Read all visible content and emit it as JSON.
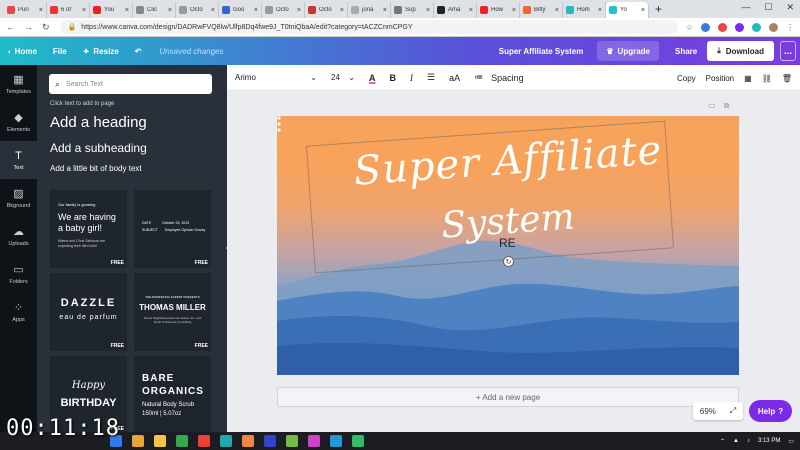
{
  "browser": {
    "tabs": [
      {
        "label": "Pun",
        "color": "#e44"
      },
      {
        "label": "6 of",
        "color": "#e33"
      },
      {
        "label": "You",
        "color": "#e22"
      },
      {
        "label": "Clic",
        "color": "#888"
      },
      {
        "label": "Octo",
        "color": "#999"
      },
      {
        "label": "Goo",
        "color": "#36c"
      },
      {
        "label": "Octo",
        "color": "#999"
      },
      {
        "label": "Octo",
        "color": "#c33"
      },
      {
        "label": "jona",
        "color": "#aaa"
      },
      {
        "label": "Sup",
        "color": "#777"
      },
      {
        "label": "Ama",
        "color": "#222"
      },
      {
        "label": "How",
        "color": "#e22"
      },
      {
        "label": "Bitly",
        "color": "#e63"
      },
      {
        "label": "Hom",
        "color": "#2bb"
      },
      {
        "label": "Yo",
        "color": "#20c4cb",
        "active": true
      }
    ],
    "new_tab": "+",
    "window_controls": [
      "—",
      "☐",
      "✕"
    ],
    "url": "https://www.canva.com/design/DADRwFVQ8lw/Ulfp8Dq4fwe9J_T0tniQbaA/edit?category=tACZCnmCPGY"
  },
  "header": {
    "home": "Home",
    "file": "File",
    "resize": "Resize",
    "unsaved": "Unsaved changes",
    "design_title": "Super Affiliate System",
    "upgrade": "Upgrade",
    "share": "Share",
    "download": "Download",
    "more": "..."
  },
  "rail": {
    "items": [
      {
        "label": "Templates",
        "icon": "▦"
      },
      {
        "label": "Elements",
        "icon": "◆"
      },
      {
        "label": "Text",
        "icon": "T"
      },
      {
        "label": "Bkground",
        "icon": "▨"
      },
      {
        "label": "Uploads",
        "icon": "☁"
      },
      {
        "label": "Folders",
        "icon": "▭"
      },
      {
        "label": "Apps",
        "icon": "⁘"
      }
    ]
  },
  "panel": {
    "search_placeholder": "Search Text",
    "hint": "Click text to add to page",
    "add_heading": "Add a heading",
    "add_subheading": "Add a subheading",
    "add_body": "Add a little bit of body text",
    "free": "FREE",
    "templates": {
      "t1": {
        "small": "Our family is growing",
        "big": "We are having a baby girl!",
        "sub": "Milena and Chris Sebiosta are expecting their third child"
      },
      "t2": {
        "r1a": "DATE",
        "r1b": "October 23, 2019",
        "r2a": "SUBJECT",
        "r2b": "Employee Opinion Survey"
      },
      "t3": {
        "big": "DAZZLE",
        "sub": "eau de parfum"
      },
      "t4": {
        "small": "THE MARKETING EXPERT PRESENTS",
        "big": "THOMAS MILLER",
        "sub": "Senior Digital Executive at Larana, Inc. and Smith & Partners Consulting"
      },
      "t5": {
        "line1": "Happy",
        "line2": "BIRTHDAY"
      },
      "t6": {
        "line1": "BARE",
        "line2": "ORGANICS",
        "line3": "Natural Body Scrub",
        "line4": "150ml | 5.07oz"
      }
    }
  },
  "toolbar": {
    "font": "Arimo",
    "size": "24",
    "color_icon": "A",
    "bold": "B",
    "italic": "I",
    "case": "aA",
    "spacing": "Spacing",
    "copy": "Copy",
    "position": "Position"
  },
  "canvas": {
    "title_line1": "Super Affiliate",
    "title_line2": "System",
    "cursor_text": "RE",
    "add_page": "+ Add a new page",
    "zoom": "69%",
    "help": "Help",
    "help_suffix": "?"
  },
  "taskbar": {
    "apps": [
      "#2d7be5",
      "#e8a33b",
      "#f5c542",
      "#34a853",
      "#ea4335",
      "#2aa",
      "#e84",
      "#34c",
      "#7b4",
      "#c4c",
      "#29d",
      "#3b6"
    ],
    "time": "3:13 PM"
  },
  "video_timer": "00:11:18",
  "colors": {
    "accent": "#7d2ae8",
    "header_start": "#1fbcc8",
    "header_end": "#7a3ce0",
    "panel": "#293039"
  }
}
